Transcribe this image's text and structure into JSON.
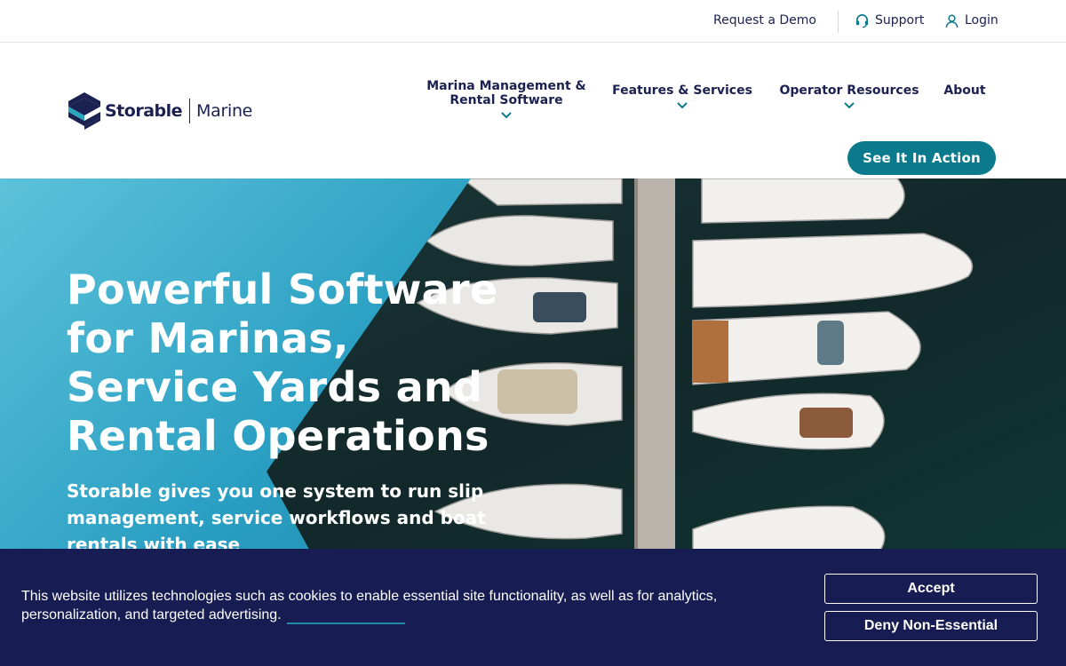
{
  "utility_nav": {
    "request_demo": "Request a Demo",
    "support": "Support",
    "login": "Login",
    "support_icon": "headset-icon",
    "login_icon": "user-icon"
  },
  "brand": {
    "name": "Storable",
    "product": "Marine",
    "logo_icon": "storable-logo-icon"
  },
  "main_nav": {
    "items": [
      {
        "label": "Marina Management & Rental Software"
      },
      {
        "label": "Features & Services"
      },
      {
        "label": "Operator Resources"
      },
      {
        "label": "About"
      }
    ],
    "cta_label": "See It In Action"
  },
  "hero": {
    "title": "Powerful Software for Marinas, Service Yards and Rental Operations",
    "subtitle": "Storable gives you one system to run slip management, service workflows and boat rentals with ease"
  },
  "cookie_banner": {
    "text": "This website utilizes technologies such as cookies to enable essential site functionality, as well as for analytics, personalization, and targeted advertising.",
    "accept_label": "Accept",
    "deny_label": "Deny Non-Essential"
  },
  "colors": {
    "navy": "#1b2150",
    "teal": "#0b7a8c",
    "banner": "#171c52",
    "water": "#2a9fc2"
  }
}
